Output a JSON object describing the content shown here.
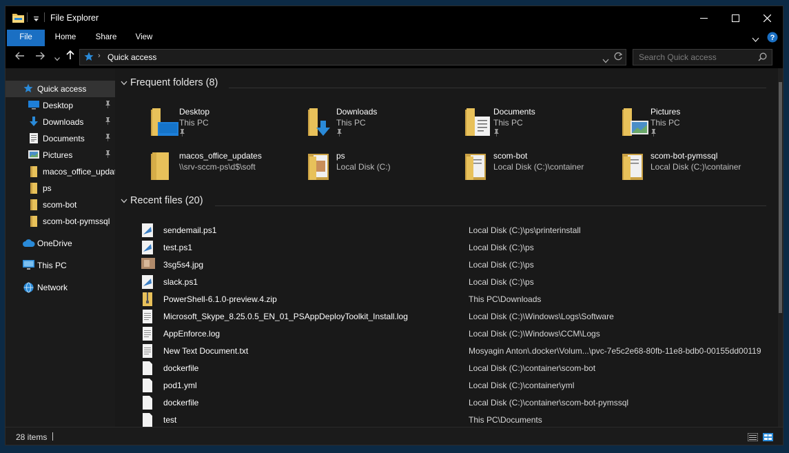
{
  "window": {
    "title": "File Explorer"
  },
  "ribbon": {
    "tabs": {
      "file": "File",
      "home": "Home",
      "share": "Share",
      "view": "View"
    }
  },
  "address": {
    "path": "Quick access"
  },
  "search": {
    "placeholder": "Search Quick access"
  },
  "nav": {
    "quick_access": "Quick access",
    "items": [
      {
        "label": "Desktop",
        "icon": "desktop-icon",
        "pinned": true
      },
      {
        "label": "Downloads",
        "icon": "download-icon",
        "pinned": true
      },
      {
        "label": "Documents",
        "icon": "documents-icon",
        "pinned": true
      },
      {
        "label": "Pictures",
        "icon": "pictures-icon",
        "pinned": true
      },
      {
        "label": "macos_office_updates",
        "icon": "folder-icon",
        "pinned": false
      },
      {
        "label": "ps",
        "icon": "folder-icon",
        "pinned": false
      },
      {
        "label": "scom-bot",
        "icon": "folder-icon",
        "pinned": false
      },
      {
        "label": "scom-bot-pymssql",
        "icon": "folder-icon",
        "pinned": false
      }
    ],
    "onedrive": "OneDrive",
    "this_pc": "This PC",
    "network": "Network"
  },
  "frequent": {
    "header": "Frequent folders (8)",
    "folders": [
      {
        "name": "Desktop",
        "location": "This PC",
        "pinned": true,
        "icon": "desktop-folder-icon"
      },
      {
        "name": "Downloads",
        "location": "This PC",
        "pinned": true,
        "icon": "downloads-folder-icon"
      },
      {
        "name": "Documents",
        "location": "This PC",
        "pinned": true,
        "icon": "documents-folder-icon"
      },
      {
        "name": "Pictures",
        "location": "This PC",
        "pinned": true,
        "icon": "pictures-folder-icon"
      },
      {
        "name": "macos_office_updates",
        "location": "\\\\srv-sccm-ps\\d$\\soft",
        "pinned": false,
        "icon": "folder-icon"
      },
      {
        "name": "ps",
        "location": "Local Disk (C:)",
        "pinned": false,
        "icon": "folder-icon"
      },
      {
        "name": "scom-bot",
        "location": "Local Disk (C:)\\container",
        "pinned": false,
        "icon": "folder-icon"
      },
      {
        "name": "scom-bot-pymssql",
        "location": "Local Disk (C:)\\container",
        "pinned": false,
        "icon": "folder-icon"
      }
    ]
  },
  "recent": {
    "header": "Recent files (20)",
    "files": [
      {
        "name": "sendemail.ps1",
        "location": "Local Disk (C:)\\ps\\printerinstall",
        "icon": "script-file-icon"
      },
      {
        "name": "test.ps1",
        "location": "Local Disk (C:)\\ps",
        "icon": "script-file-icon"
      },
      {
        "name": "3sg5s4.jpg",
        "location": "Local Disk (C:)\\ps",
        "icon": "image-file-icon"
      },
      {
        "name": "slack.ps1",
        "location": "Local Disk (C:)\\ps",
        "icon": "script-file-icon"
      },
      {
        "name": "PowerShell-6.1.0-preview.4.zip",
        "location": "This PC\\Downloads",
        "icon": "zip-file-icon"
      },
      {
        "name": "Microsoft_Skype_8.25.0.5_EN_01_PSAppDeployToolkit_Install.log",
        "location": "Local Disk (C:)\\Windows\\Logs\\Software",
        "icon": "text-file-icon"
      },
      {
        "name": "AppEnforce.log",
        "location": "Local Disk (C:)\\Windows\\CCM\\Logs",
        "icon": "text-file-icon"
      },
      {
        "name": "New Text Document.txt",
        "location": "Mosyagin Anton\\.docker\\Volum...\\pvc-7e5c2e68-80fb-11e8-bdb0-00155dd00119",
        "icon": "text-file-icon"
      },
      {
        "name": "dockerfile",
        "location": "Local Disk (C:)\\container\\scom-bot",
        "icon": "blank-file-icon"
      },
      {
        "name": "pod1.yml",
        "location": "Local Disk (C:)\\container\\yml",
        "icon": "blank-file-icon"
      },
      {
        "name": "dockerfile",
        "location": "Local Disk (C:)\\container\\scom-bot-pymssql",
        "icon": "blank-file-icon"
      },
      {
        "name": "test",
        "location": "This PC\\Documents",
        "icon": "blank-file-icon"
      }
    ]
  },
  "status": {
    "count": "28 items"
  },
  "colors": {
    "accent": "#1a6fc3",
    "folder": "#e8c15a",
    "background": "#191919"
  }
}
